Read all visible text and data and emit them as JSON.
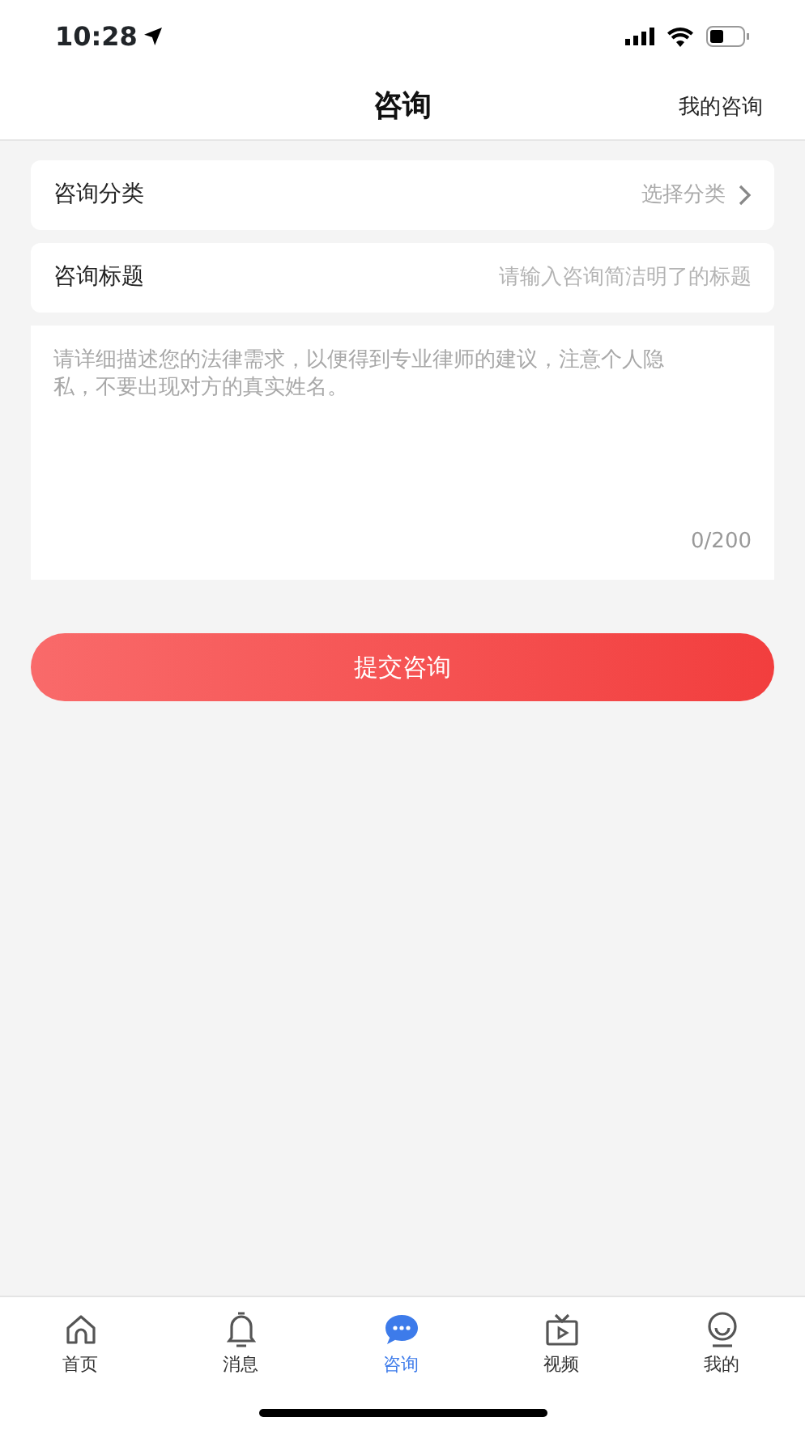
{
  "status_bar": {
    "time": "10:28"
  },
  "header": {
    "title": "咨询",
    "action": "我的咨询"
  },
  "form": {
    "category": {
      "label": "咨询分类",
      "value": "选择分类"
    },
    "title_field": {
      "label": "咨询标题",
      "placeholder": "请输入咨询简洁明了的标题"
    },
    "description": {
      "placeholder": "请详细描述您的法律需求，以便得到专业律师的建议，注意个人隐私，不要出现对方的真实姓名。",
      "counter": "0/200"
    },
    "submit": "提交咨询"
  },
  "tab_bar": [
    {
      "label": "首页",
      "selected": false
    },
    {
      "label": "消息",
      "selected": false
    },
    {
      "label": "咨询",
      "selected": true
    },
    {
      "label": "视频",
      "selected": false
    },
    {
      "label": "我的",
      "selected": false
    }
  ]
}
